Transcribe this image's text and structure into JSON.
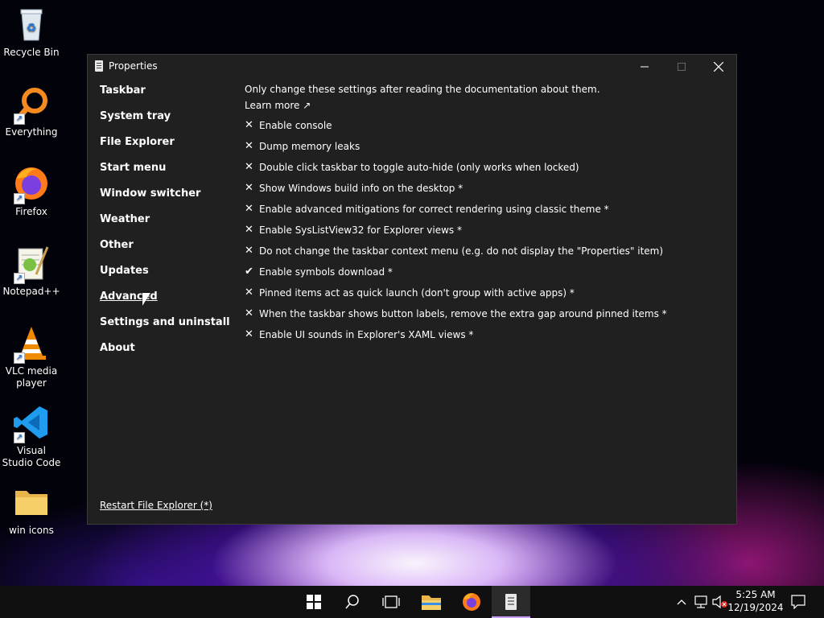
{
  "desktop": {
    "icons": [
      {
        "label": "Recycle Bin"
      },
      {
        "label": "Everything"
      },
      {
        "label": "Firefox"
      },
      {
        "label": "Notepad++"
      },
      {
        "label": "VLC media player"
      },
      {
        "label": "Visual Studio Code"
      },
      {
        "label": "win icons"
      }
    ]
  },
  "window": {
    "title": "Properties",
    "caption": {
      "minimize": "─",
      "maximize": "☐",
      "close": "✕"
    },
    "sidebar": {
      "items": [
        {
          "label": "Taskbar"
        },
        {
          "label": "System tray"
        },
        {
          "label": "File Explorer"
        },
        {
          "label": "Start menu"
        },
        {
          "label": "Window switcher"
        },
        {
          "label": "Weather"
        },
        {
          "label": "Other"
        },
        {
          "label": "Updates"
        },
        {
          "label": "Advanced",
          "active": true
        },
        {
          "label": "Settings and uninstall"
        },
        {
          "label": "About"
        }
      ],
      "restart_link": "Restart File Explorer (*)"
    },
    "content": {
      "note": "Only change these settings after reading the documentation about them.",
      "learn_more": "Learn more ↗",
      "settings": [
        {
          "mark": "✕",
          "checked": false,
          "label": "Enable console"
        },
        {
          "mark": "✕",
          "checked": false,
          "label": "Dump memory leaks"
        },
        {
          "mark": "✕",
          "checked": false,
          "label": "Double click taskbar to toggle auto-hide (only works when locked)"
        },
        {
          "mark": "✕",
          "checked": false,
          "label": "Show Windows build info on the desktop *"
        },
        {
          "mark": "✕",
          "checked": false,
          "label": "Enable advanced mitigations for correct rendering using classic theme *"
        },
        {
          "mark": "✕",
          "checked": false,
          "label": "Enable SysListView32 for Explorer views *"
        },
        {
          "mark": "✕",
          "checked": false,
          "label": "Do not change the taskbar context menu (e.g. do not display the \"Properties\" item)"
        },
        {
          "mark": "✔",
          "checked": true,
          "label": "Enable symbols download *"
        },
        {
          "mark": "✕",
          "checked": false,
          "label": "Pinned items act as quick launch (don't group with active apps) *"
        },
        {
          "mark": "✕",
          "checked": false,
          "label": "When the taskbar shows button labels, remove the extra gap around pinned items *"
        },
        {
          "mark": "✕",
          "checked": false,
          "label": "Enable UI sounds in Explorer's XAML views *"
        }
      ]
    }
  },
  "taskbar": {
    "clock_time": "5:25 AM",
    "clock_date": "12/19/2024"
  },
  "colors": {
    "window_bg": "#202020",
    "taskbar_bg": "#101010",
    "accent": "#c9a0ff"
  }
}
